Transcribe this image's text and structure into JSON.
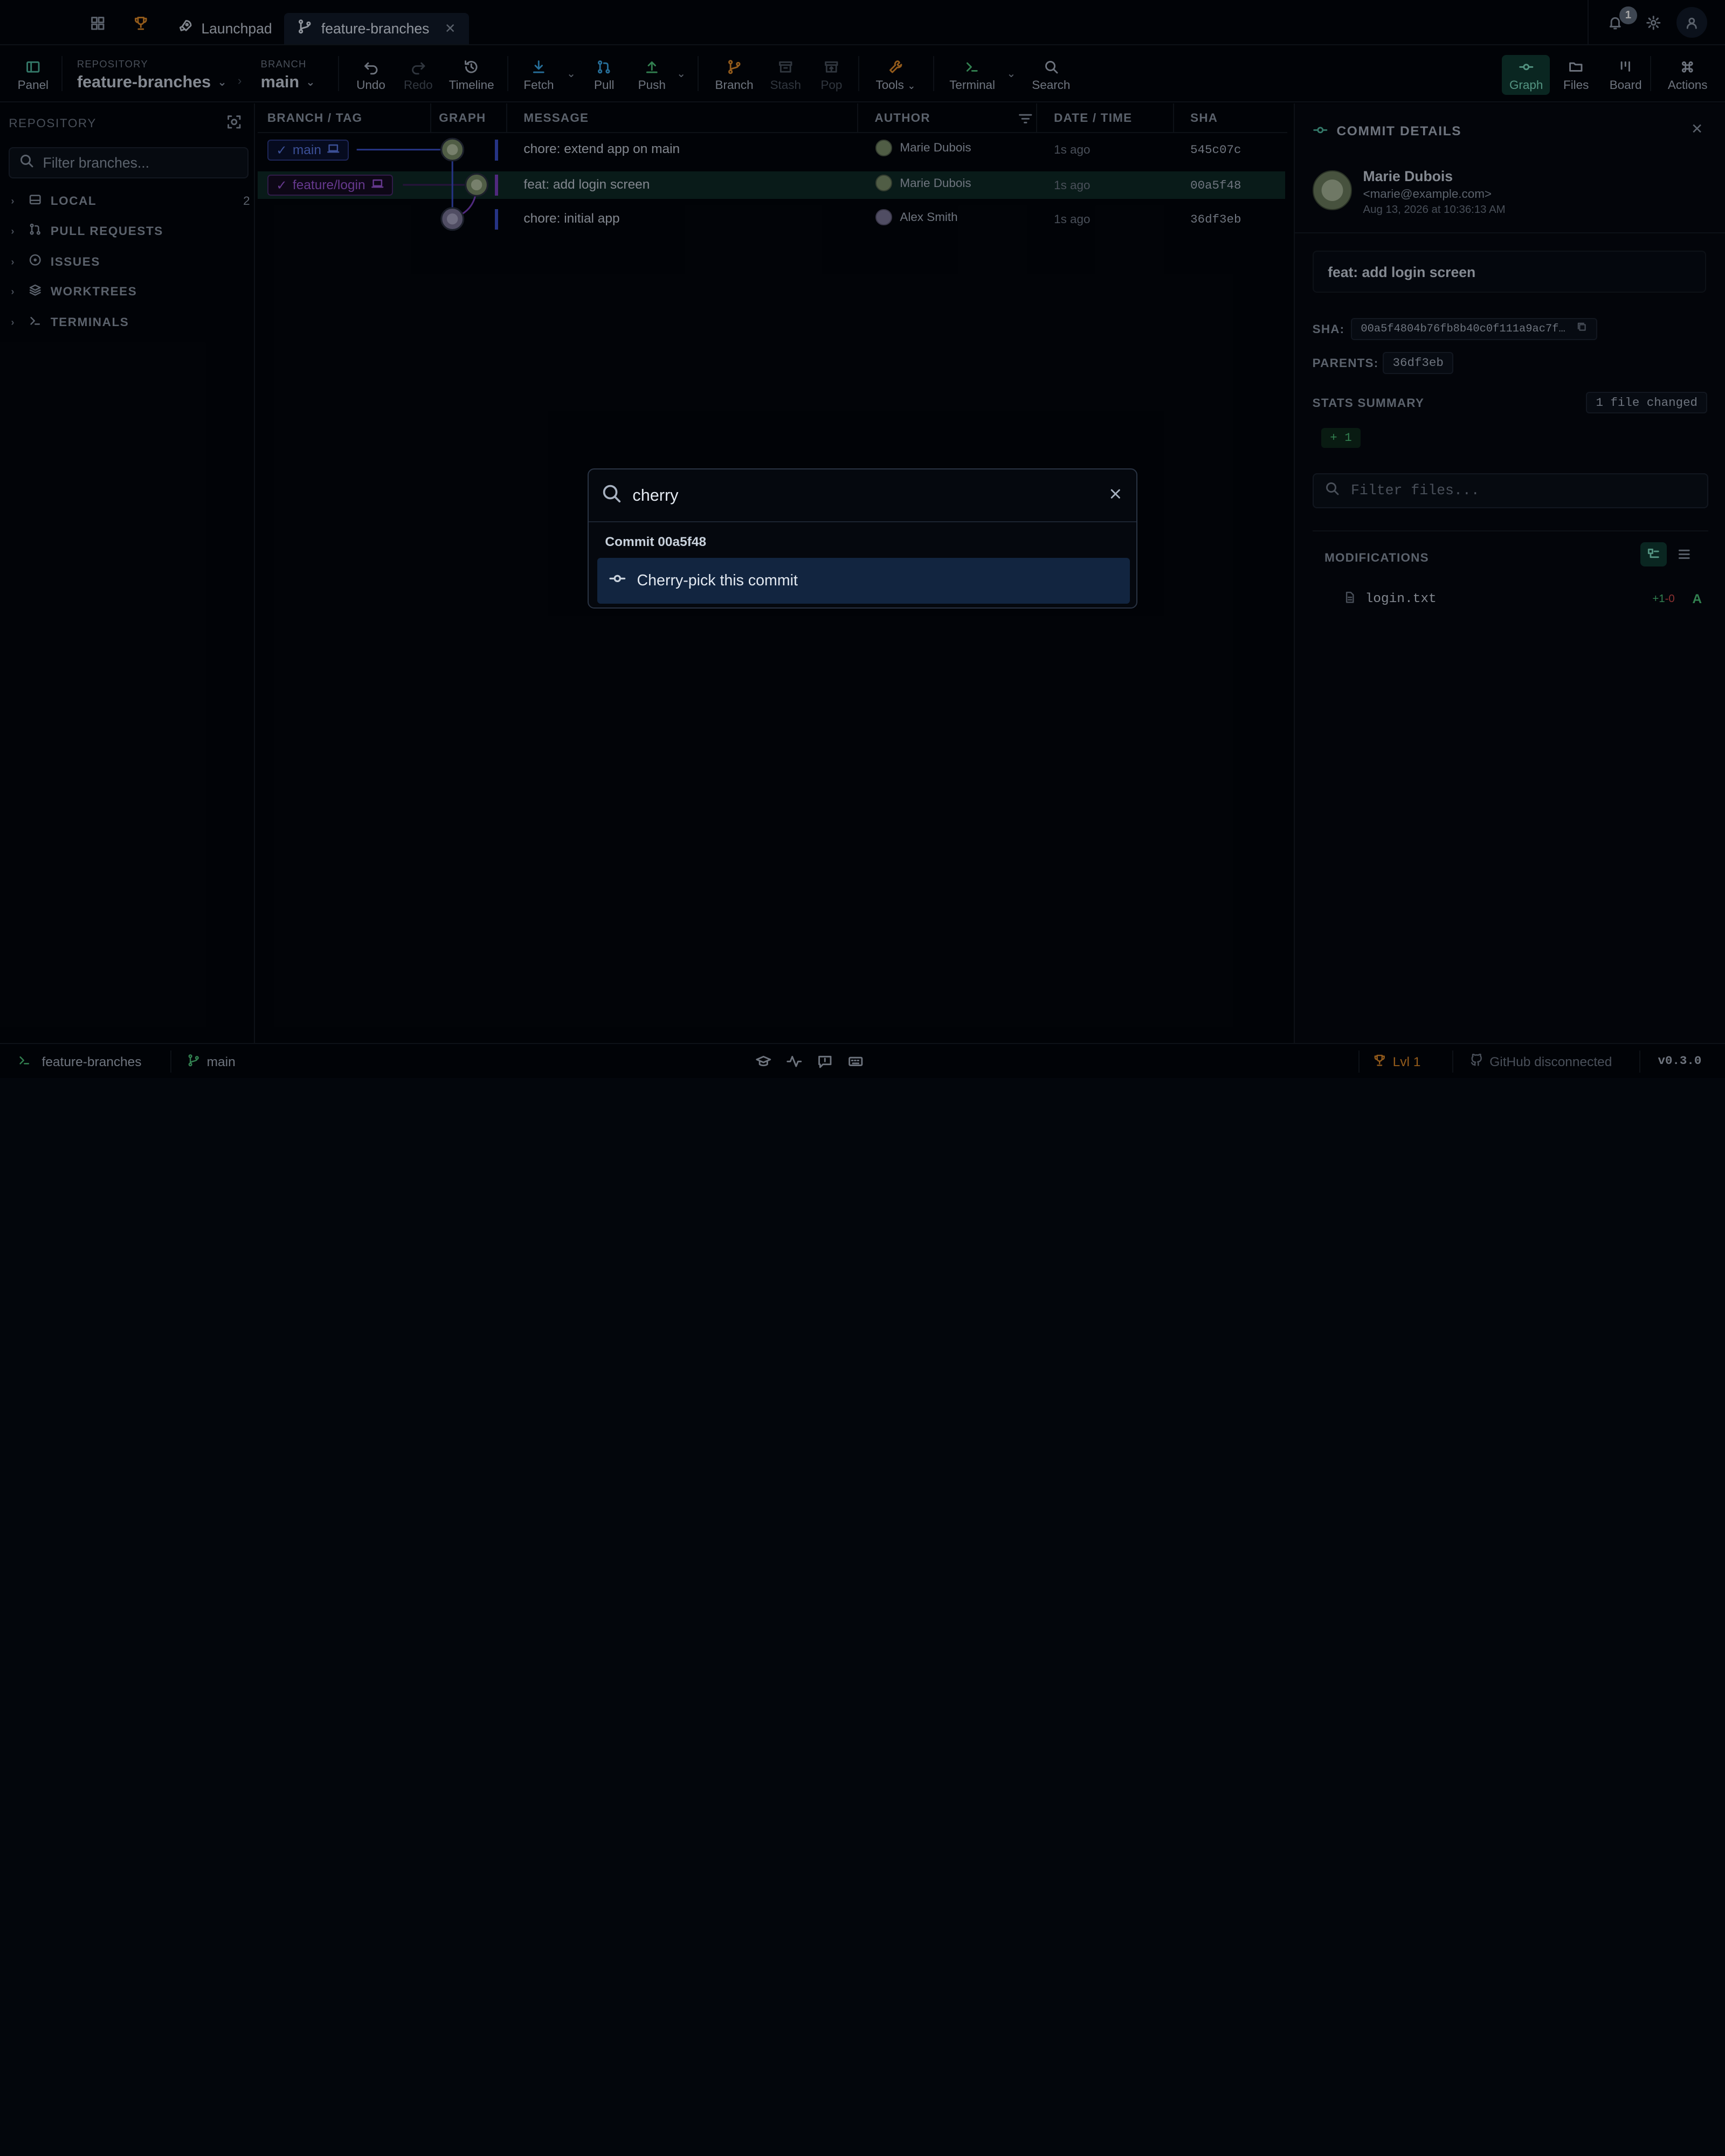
{
  "tabs": {
    "home_icon": "grid-icon",
    "achievements_icon": "trophy-icon",
    "launchpad_label": "Launchpad",
    "repo_tab_label": "feature-branches",
    "notifications_count": "1"
  },
  "toolbar": {
    "panel_label": "Panel",
    "repository_caption": "REPOSITORY",
    "repository_value": "feature-branches",
    "branch_caption": "BRANCH",
    "branch_value": "main",
    "undo_label": "Undo",
    "redo_label": "Redo",
    "timeline_label": "Timeline",
    "fetch_label": "Fetch",
    "pull_label": "Pull",
    "push_label": "Push",
    "branch_label": "Branch",
    "stash_label": "Stash",
    "pop_label": "Pop",
    "tools_label": "Tools",
    "terminal_label": "Terminal",
    "search_label": "Search",
    "graph_label": "Graph",
    "files_label": "Files",
    "board_label": "Board",
    "actions_label": "Actions"
  },
  "sidebar": {
    "title": "REPOSITORY",
    "filter_placeholder": "Filter branches...",
    "items": [
      {
        "label": "LOCAL",
        "count": "2",
        "icon": "drive-icon"
      },
      {
        "label": "PULL REQUESTS",
        "count": "",
        "icon": "pull-request-icon"
      },
      {
        "label": "ISSUES",
        "count": "",
        "icon": "issue-icon"
      },
      {
        "label": "WORKTREES",
        "count": "",
        "icon": "layers-icon"
      },
      {
        "label": "TERMINALS",
        "count": "",
        "icon": "terminal-icon"
      }
    ]
  },
  "graph": {
    "columns": {
      "branch": "BRANCH / TAG",
      "graph": "GRAPH",
      "message": "MESSAGE",
      "author": "AUTHOR",
      "date": "DATE / TIME",
      "sha": "SHA"
    },
    "commits": [
      {
        "ref": "main",
        "message": "chore: extend app on main",
        "author": "Marie Dubois",
        "time": "1s ago",
        "sha": "545c07c"
      },
      {
        "ref": "feature/login",
        "message": "feat: add login screen",
        "author": "Marie Dubois",
        "time": "1s ago",
        "sha": "00a5f48"
      },
      {
        "ref": "",
        "message": "chore: initial app",
        "author": "Alex Smith",
        "time": "1s ago",
        "sha": "36df3eb"
      }
    ],
    "colors": {
      "main": "#5a78e3",
      "feature": "#9a55d6",
      "selected_row": "#0f2a26"
    }
  },
  "details": {
    "title": "COMMIT DETAILS",
    "author_name": "Marie Dubois",
    "author_email": "<marie@example.com>",
    "date": "Aug 13, 2026 at 10:36:13 AM",
    "message": "feat: add login screen",
    "sha_label": "SHA:",
    "sha_value": "00a5f4804b76fb8b40c0f111a9ac7f…",
    "parents_label": "PARENTS:",
    "parents_value": "36df3eb",
    "stats_label": "STATS SUMMARY",
    "files_changed": "1 file changed",
    "additions": "+ 1",
    "filter_placeholder": "Filter files...",
    "modifications_label": "MODIFICATIONS",
    "files": [
      {
        "name": "login.txt",
        "added": "+1",
        "removed": "-0",
        "status": "A"
      }
    ]
  },
  "palette": {
    "query": "cherry",
    "group_label": "Commit 00a5f48",
    "items": [
      {
        "label": "Cherry-pick this commit",
        "icon": "commit-icon"
      }
    ]
  },
  "statusbar": {
    "repo": "feature-branches",
    "branch": "main",
    "level": "Lvl 1",
    "github": "GitHub disconnected",
    "version": "v0.3.0"
  }
}
